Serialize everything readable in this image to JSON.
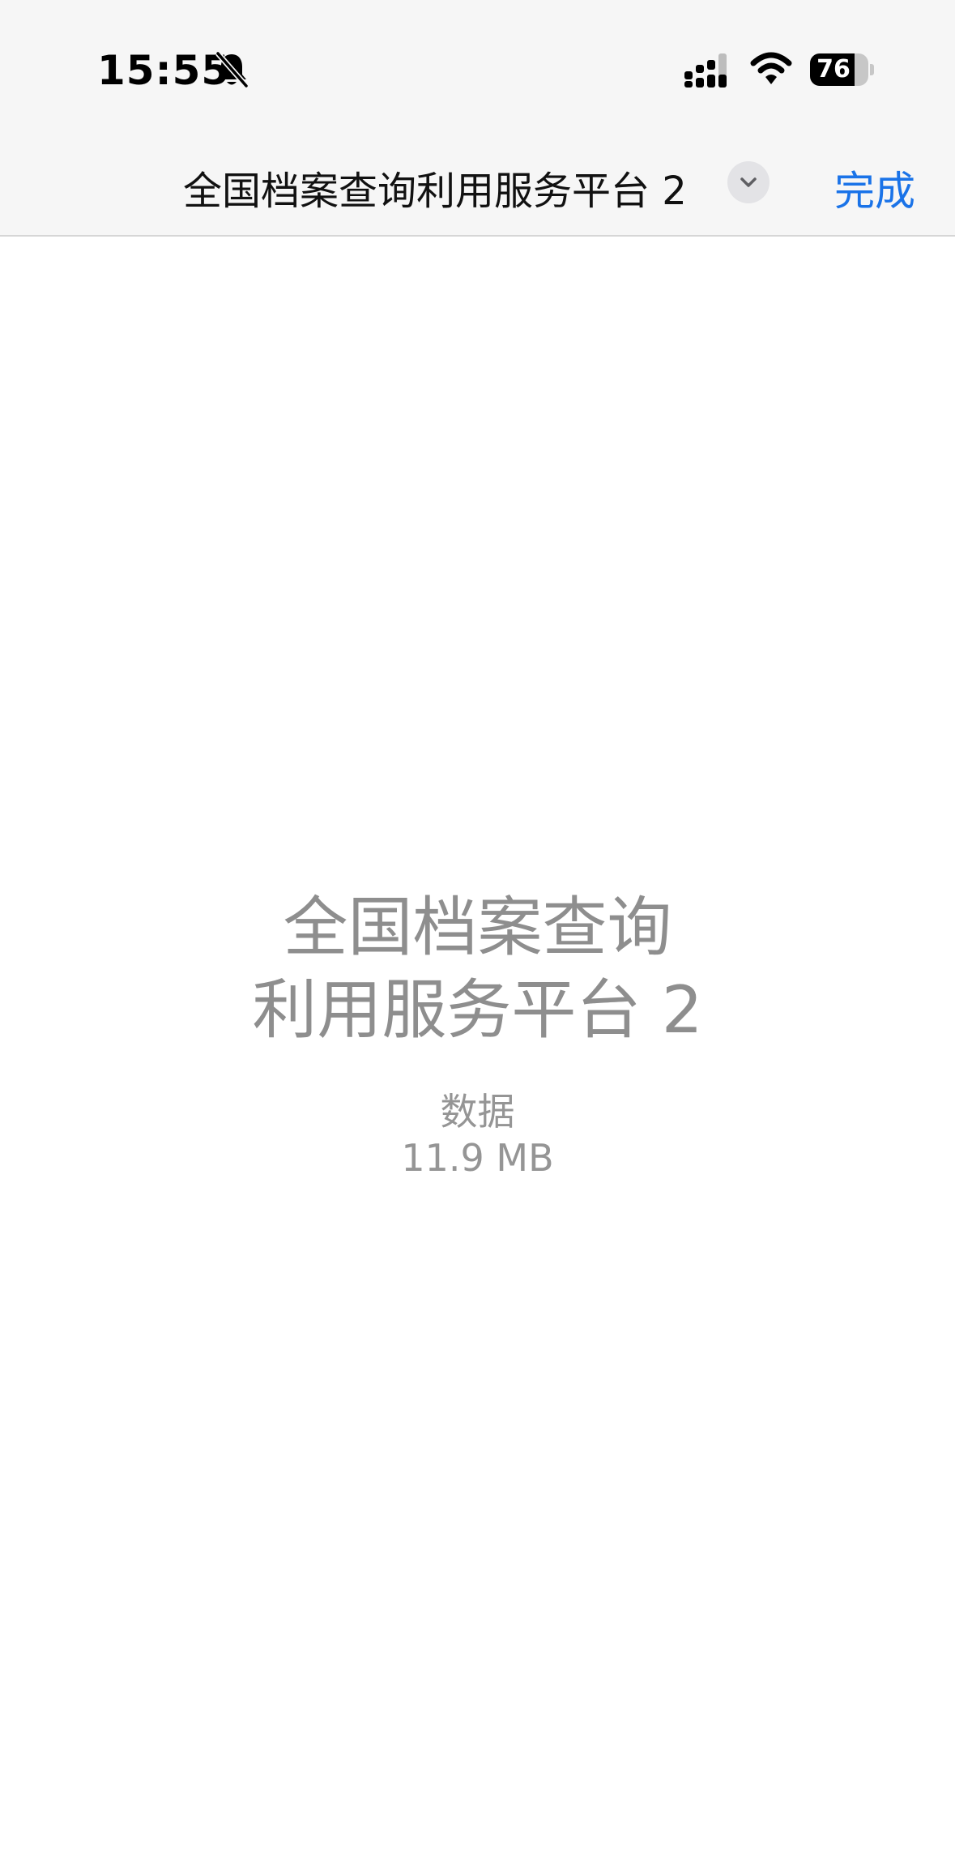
{
  "status_bar": {
    "time": "15:55",
    "battery_level": "76",
    "battery_fraction": 0.76,
    "icons": [
      "bell-off-icon",
      "cellular-signal-icon",
      "wifi-icon",
      "battery-icon"
    ]
  },
  "nav": {
    "title": "全国档案查询利用服务平台 2",
    "done_label": "完成",
    "menu_icon": "chevron-down-icon",
    "accent_color": "#1a73e8"
  },
  "document": {
    "title_line1": "全国档案查询",
    "title_line2": "利用服务平台 2",
    "type_label": "数据",
    "size": "11.9 MB"
  }
}
